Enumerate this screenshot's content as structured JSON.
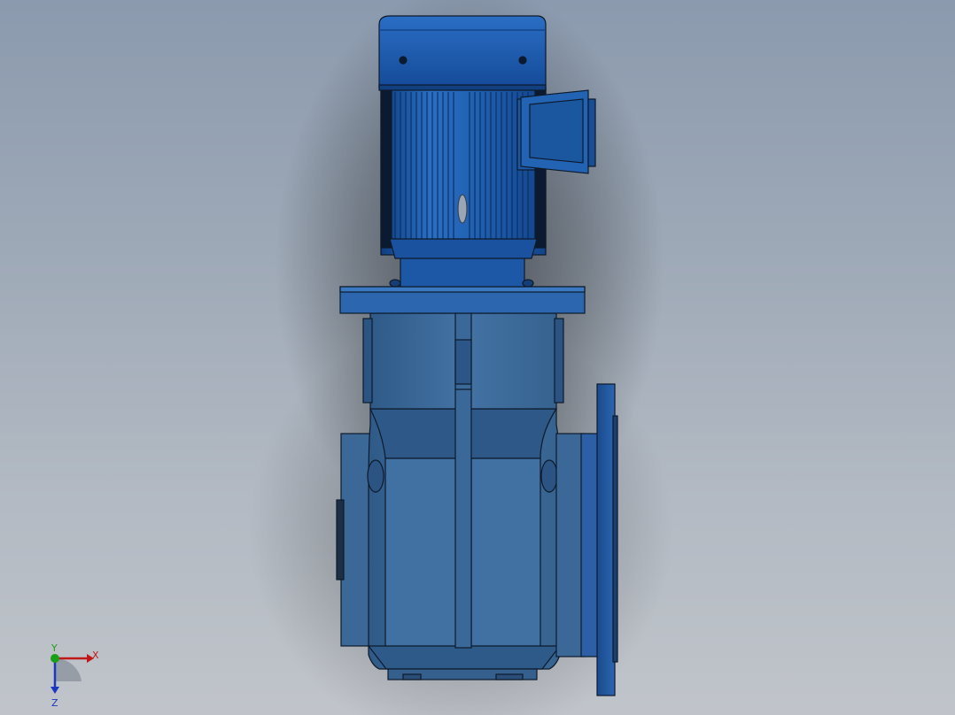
{
  "view": {
    "background_top": "#8b9aae",
    "background_bottom": "#c0c4ca"
  },
  "model": {
    "body_color": "#3f6d9c",
    "motor_color": "#1f5fb0",
    "edge_color": "#0d1a2b"
  },
  "triad": {
    "x_label": "X",
    "y_label": "Y",
    "z_label": "Z",
    "x_color": "#c01818",
    "y_color": "#18a018",
    "z_color": "#1838c0"
  }
}
